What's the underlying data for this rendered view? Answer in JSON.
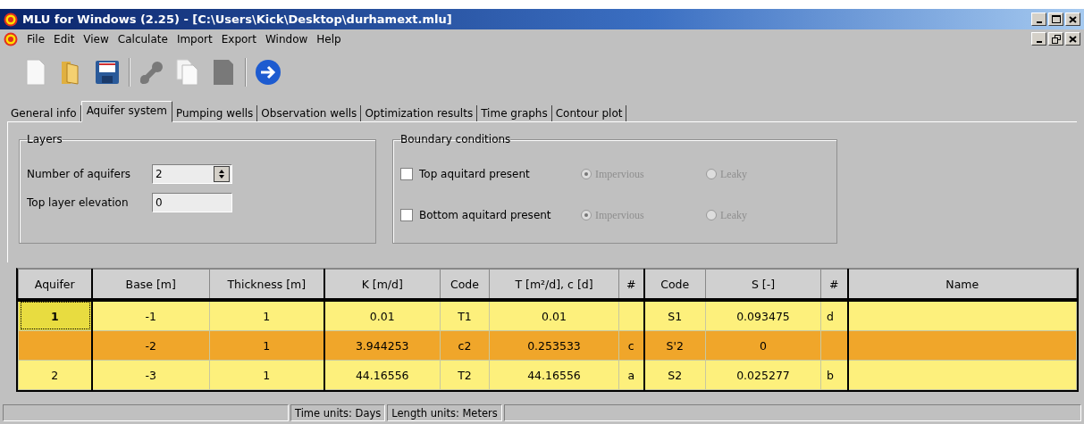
{
  "window": {
    "title": "MLU for Windows (2.25) - [C:\\Users\\Kick\\Desktop\\durhamext.mlu]"
  },
  "menu": [
    "File",
    "Edit",
    "View",
    "Calculate",
    "Import",
    "Export",
    "Window",
    "Help"
  ],
  "toolbar": [
    {
      "kind": "new",
      "disabled": false
    },
    {
      "kind": "open",
      "disabled": false
    },
    {
      "kind": "save",
      "disabled": false
    },
    {
      "kind": "sep"
    },
    {
      "kind": "tools",
      "disabled": true
    },
    {
      "kind": "copy",
      "disabled": false
    },
    {
      "kind": "paste",
      "disabled": true
    },
    {
      "kind": "sep"
    },
    {
      "kind": "run",
      "disabled": false
    }
  ],
  "tabs": [
    {
      "label": "General info",
      "selected": false
    },
    {
      "label": "Aquifer system",
      "selected": true
    },
    {
      "label": "Pumping wells",
      "selected": false
    },
    {
      "label": "Observation wells",
      "selected": false
    },
    {
      "label": "Optimization results",
      "selected": false
    },
    {
      "label": "Time graphs",
      "selected": false
    },
    {
      "label": "Contour plot",
      "selected": false
    }
  ],
  "layers": {
    "title": "Layers",
    "fields": [
      {
        "label": "Number of aquifers",
        "value": "2",
        "kind": "spin"
      },
      {
        "label": "Top layer elevation",
        "value": "0",
        "kind": "text"
      }
    ]
  },
  "boundary": {
    "title": "Boundary conditions",
    "rows": [
      {
        "label": "Top aquitard present",
        "checked": false,
        "options": [
          {
            "label": "Impervious",
            "selected": true
          },
          {
            "label": "Leaky",
            "selected": false
          }
        ]
      },
      {
        "label": "Bottom aquitard present",
        "checked": false,
        "options": [
          {
            "label": "Impervious",
            "selected": true
          },
          {
            "label": "Leaky",
            "selected": false
          }
        ]
      }
    ]
  },
  "table": {
    "columns": [
      "Aquifer",
      "Base [m]",
      "Thickness [m]",
      "K [m/d]",
      "Code",
      "T [m²/d], c [d]",
      "#",
      "Code",
      "S [-]",
      "#",
      "Name"
    ],
    "rows": [
      {
        "kind": "aquifer",
        "selected": true,
        "cells": [
          "1",
          "-1",
          "1",
          "0.01",
          "T1",
          "0.01",
          "",
          "S1",
          "0.093475",
          "d",
          ""
        ]
      },
      {
        "kind": "aquitard",
        "selected": false,
        "cells": [
          "",
          "-2",
          "1",
          "3.944253",
          "c2",
          "0.253533",
          "c",
          "S'2",
          "0",
          "",
          " "
        ]
      },
      {
        "kind": "aquifer",
        "selected": false,
        "cells": [
          "2",
          "-3",
          "1",
          "44.16556",
          "T2",
          "44.16556",
          "a",
          "S2",
          "0.025277",
          "b",
          ""
        ]
      }
    ]
  },
  "status_bar": [
    "Time units: Days",
    "Length units: Meters"
  ]
}
